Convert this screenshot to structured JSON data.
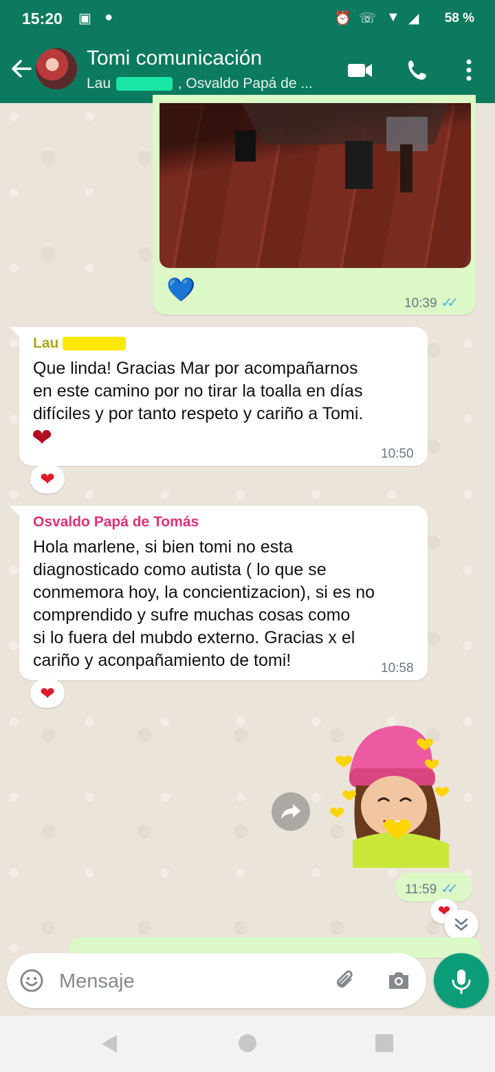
{
  "status_bar": {
    "time": "15:20",
    "battery": "58 %"
  },
  "header": {
    "title": "Tomi comunicación",
    "subtitle_prefix": "Lau",
    "subtitle_suffix": ", Osvaldo Papá de ..."
  },
  "messages": [
    {
      "type": "image",
      "direction": "out",
      "reaction_in_bubble": "💙",
      "time": "10:39",
      "status_ticks": "✓✓"
    },
    {
      "direction": "in",
      "sender": "Lau",
      "text_lines": [
        "Que linda! Gracias Mar por acompañarnos",
        "en este camino por no tirar la toalla en días",
        "difíciles y por tanto respeto y cariño a Tomi."
      ],
      "emoji": "❤",
      "time": "10:50",
      "reaction": "❤"
    },
    {
      "direction": "in",
      "sender": "Osvaldo Papá de Tomás",
      "text_lines": [
        "Hola marlene, si bien tomi no esta",
        "diagnosticado como autista ( lo que se",
        "conmemora hoy, la concientizacion), si es no",
        "comprendido y sufre muchas cosas como",
        "si lo fuera del mubdo externo. Gracias x el",
        "cariño y aconpañamiento de tomi!"
      ],
      "time": "10:58",
      "reaction": "❤"
    },
    {
      "type": "sticker",
      "direction": "out",
      "time": "11:59",
      "status_ticks": "✓✓",
      "reaction": "❤"
    }
  ],
  "input": {
    "placeholder": "Mensaje"
  },
  "colors": {
    "header": "#0b7a5e",
    "outgoing_bubble": "#dbf8c6",
    "sender_lau": "#a8a81a",
    "sender_osvaldo": "#e0307a",
    "mic_button": "#0b9d78",
    "ticks": "#4fb0e6"
  },
  "icons": [
    "back-arrow-icon",
    "video-call-icon",
    "phone-icon",
    "more-vert-icon",
    "forward-icon",
    "chevron-double-down-icon",
    "emoji-icon",
    "attach-icon",
    "camera-icon",
    "mic-icon",
    "nav-back-icon",
    "nav-home-icon",
    "nav-recents-icon"
  ]
}
